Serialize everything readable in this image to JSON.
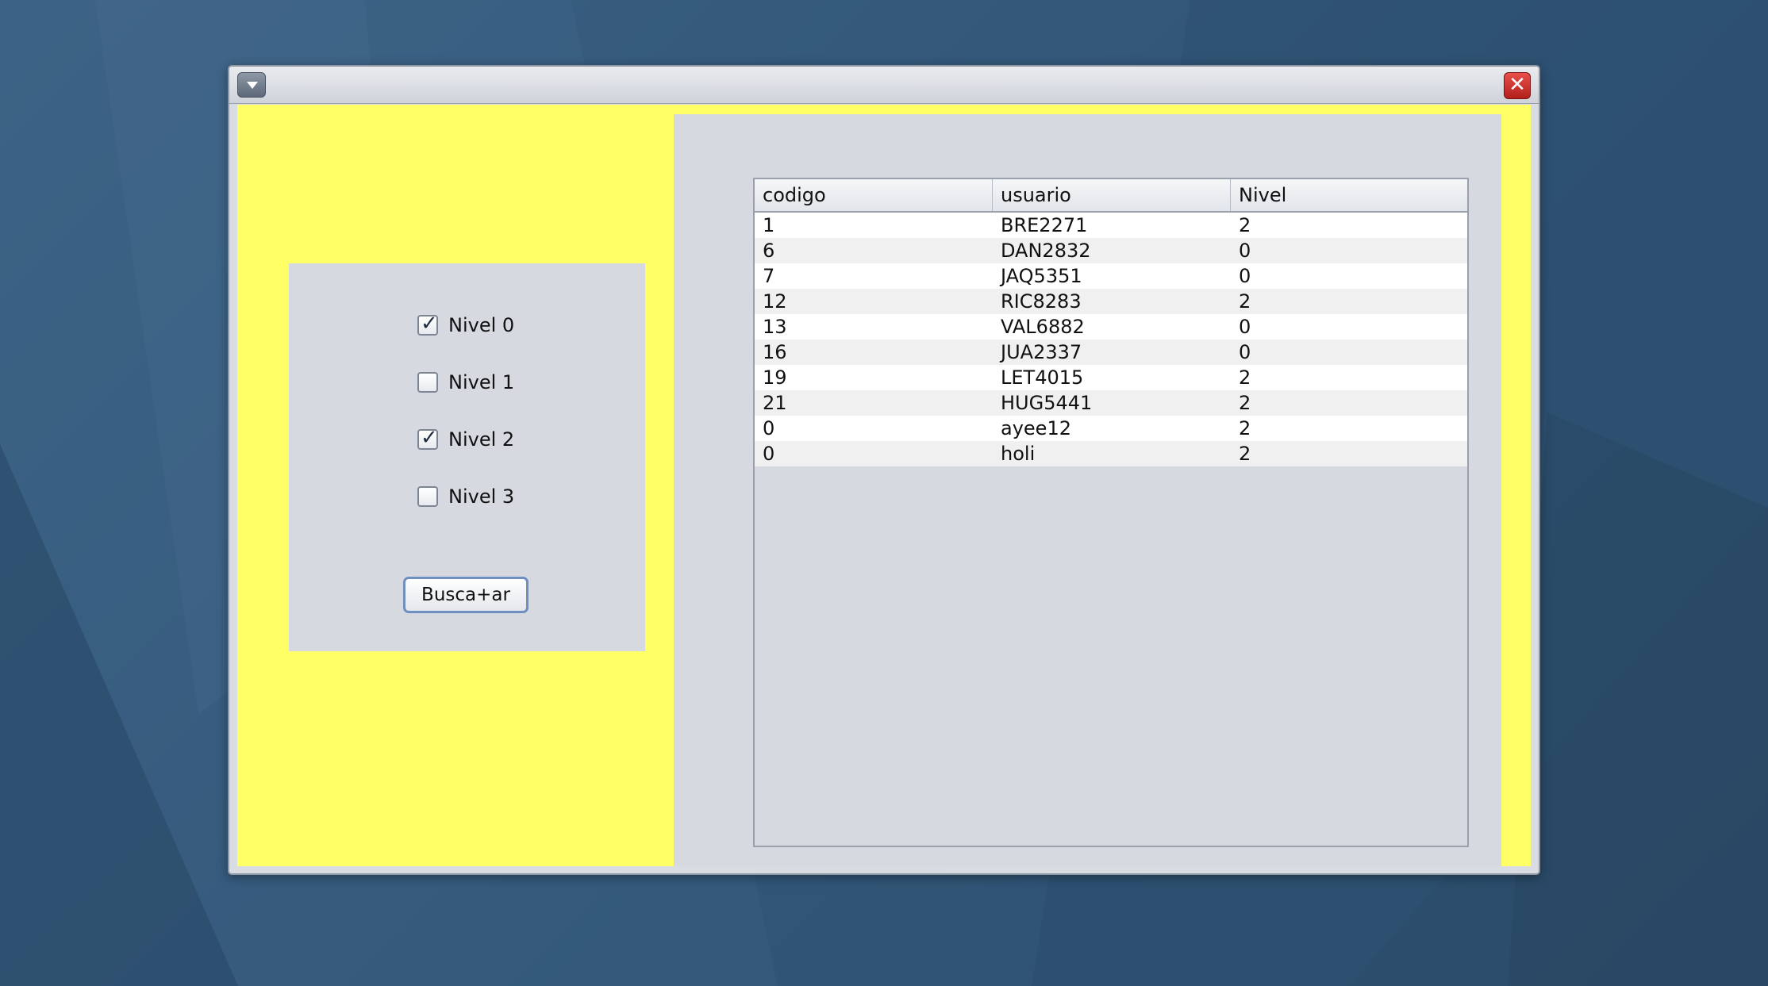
{
  "window": {
    "menu_icon": "chevron-down-icon",
    "close_icon": "close-icon",
    "close_glyph": "✕"
  },
  "colors": {
    "content_background": "#ffff66",
    "panel_background": "#d6d9e0",
    "close_button": "#c7302a"
  },
  "filters": [
    {
      "label": "Nivel 0",
      "checked": true
    },
    {
      "label": "Nivel 1",
      "checked": false
    },
    {
      "label": "Nivel 2",
      "checked": true
    },
    {
      "label": "Nivel 3",
      "checked": false
    }
  ],
  "search_button": {
    "label": "Busca+ar"
  },
  "table": {
    "columns": [
      "codigo",
      "usuario",
      "Nivel"
    ],
    "rows": [
      [
        "1",
        "BRE2271",
        "2"
      ],
      [
        "6",
        "DAN2832",
        "0"
      ],
      [
        "7",
        "JAQ5351",
        "0"
      ],
      [
        "12",
        "RIC8283",
        "2"
      ],
      [
        "13",
        "VAL6882",
        "0"
      ],
      [
        "16",
        "JUA2337",
        "0"
      ],
      [
        "19",
        "LET4015",
        "2"
      ],
      [
        "21",
        "HUG5441",
        "2"
      ],
      [
        "0",
        "ayee12",
        "2"
      ],
      [
        "0",
        "holi",
        "2"
      ]
    ]
  }
}
